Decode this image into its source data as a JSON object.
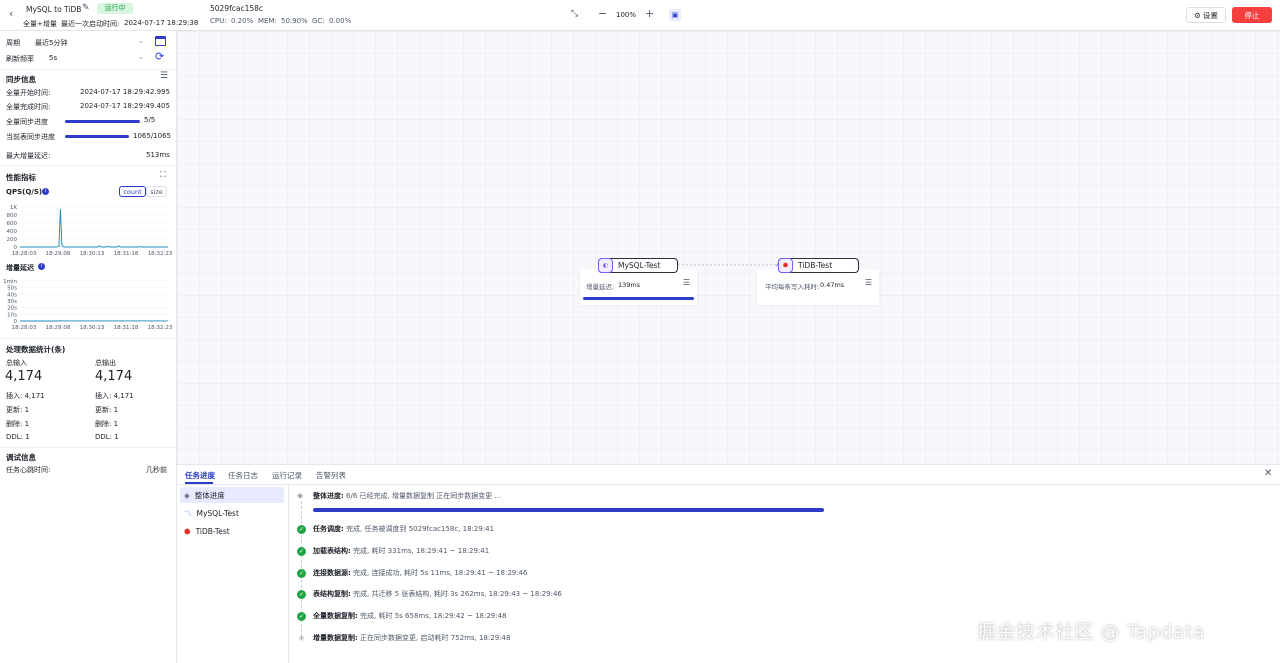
{
  "header": {
    "task_name": "MySQL to TiDB",
    "status_badge": "运行中",
    "sync_type": "全量+增量",
    "last_start_label": "最近一次启动时间:",
    "last_start_time": "2024-07-17 18:29:38",
    "task_id": "5029fcac158c",
    "cpu_label": "CPU:",
    "cpu_value": "0.20%",
    "mem_label": "MEM:",
    "mem_value": "50.90%",
    "gc_label": "GC:",
    "gc_value": "0.00%",
    "zoom": "100%",
    "settings_label": "设置",
    "stop_label": "停止",
    "accent": "#2c3cc8",
    "stop_color": "#f53f3f"
  },
  "left": {
    "period_label": "周期",
    "period_value": "最近5分钟",
    "refresh_label": "刷新频率",
    "refresh_value": "5s",
    "sync_info_title": "同步信息",
    "full_start_label": "全量开始时间:",
    "full_start_value": "2024-07-17 18:29:42.995",
    "full_done_label": "全量完成时间:",
    "full_done_value": "2024-07-17 18:29:49.405",
    "full_progress_label": "全量同步进度",
    "full_progress_value": "5/5",
    "full_progress_fraction": 1.0,
    "table_progress_label": "当前表同步进度",
    "table_progress_value": "1065/1065",
    "table_progress_fraction": 1.0,
    "max_delay_label": "最大增量延迟:",
    "max_delay_value": "513ms",
    "perf_title": "性能指标",
    "qps_label": "QPS(Q/S)",
    "count_btn": "count",
    "size_btn": "size",
    "delay_chart_label": "增量延迟",
    "stats_title": "处理数据统计(条)",
    "total_in_label": "总输入",
    "total_out_label": "总输出",
    "total_in_value": "4,174",
    "total_out_value": "4,174",
    "in_insert": "插入: 4,171",
    "in_update": "更新: 1",
    "in_delete": "删除: 1",
    "in_ddl": "DDL: 1",
    "out_insert": "插入: 4,171",
    "out_update": "更新: 1",
    "out_delete": "删除: 1",
    "out_ddl": "DDL: 1",
    "debug_title": "调试信息",
    "heartbeat_label": "任务心跳时间:",
    "heartbeat_value": "几秒前"
  },
  "chart_data": [
    {
      "type": "line",
      "title": "QPS(Q/S)",
      "yticks": [
        "1K",
        "800",
        "600",
        "400",
        "200",
        "0"
      ],
      "xticks": [
        "18:28:03",
        "18:29:08",
        "18:30:13",
        "18:31:18",
        "18:32:23"
      ],
      "ylim": [
        0,
        1000
      ],
      "series": [
        {
          "values": [
            0,
            0,
            0,
            0,
            0,
            0,
            0,
            0,
            0,
            0,
            0,
            0,
            0,
            0,
            0,
            0,
            0,
            0,
            0,
            0,
            0,
            0,
            0,
            0,
            0,
            5,
            20,
            950,
            60,
            5,
            0,
            0,
            0,
            0,
            0,
            0,
            0,
            0,
            0,
            0,
            0,
            0,
            0,
            0,
            0,
            0,
            0,
            0,
            0,
            0,
            0,
            0,
            0,
            30,
            5,
            0,
            0,
            0,
            0,
            20,
            0,
            0,
            0,
            0,
            0,
            0,
            30,
            5,
            0,
            0,
            0,
            0,
            0,
            0,
            0,
            0,
            0,
            0,
            0,
            0,
            10,
            0,
            0,
            0,
            0,
            0,
            0,
            0,
            0,
            0,
            0,
            0,
            0,
            0,
            0,
            0,
            0,
            0,
            0,
            0
          ]
        }
      ]
    },
    {
      "type": "line",
      "title": "增量延迟",
      "yticks": [
        "1min",
        "50s",
        "40s",
        "30s",
        "20s",
        "10s",
        "0"
      ],
      "xticks": [
        "18:28:03",
        "18:29:08",
        "18:30:13",
        "18:31:18",
        "18:32:23"
      ],
      "ylim": [
        0,
        60
      ],
      "series": [
        {
          "values": [
            0,
            0,
            0,
            0,
            0,
            0,
            0,
            0,
            0,
            0,
            0,
            0,
            0,
            0,
            0,
            0,
            0,
            0,
            0,
            0,
            0,
            0,
            0,
            0,
            0,
            0,
            0,
            0.5,
            0.3,
            0.2,
            0.1,
            0.2,
            0.3,
            0.2,
            0.1,
            0.2,
            0.3,
            0.2,
            0.1,
            0.2,
            0.3,
            0.2,
            0.1,
            0.2,
            0.3,
            0.2,
            0.1,
            0.2,
            0.3,
            0.2,
            0.1,
            0.2,
            0.3,
            0.2,
            0.1,
            0.2,
            0.3,
            0.2,
            0.1,
            0.2,
            0.3,
            0.2,
            0.1,
            0.2,
            0.3,
            0.2,
            0.1,
            0.2,
            0.3,
            0.2,
            0.1,
            0.2,
            0.3,
            0.2,
            0.1,
            0.2,
            0.3,
            0.2,
            0.1,
            0.2,
            0.3,
            0.2,
            0.1,
            0.2,
            0.3,
            0.2,
            0.1,
            0.2,
            0.3,
            0.2,
            0.1,
            0.2,
            0.3,
            0.2,
            0.1,
            0.2,
            0.3,
            0.2,
            0.1,
            0.2
          ]
        }
      ]
    }
  ],
  "canvas": {
    "source_name": "MySQL-Test",
    "target_name": "TiDB-Test",
    "source_metric_label": "增量延迟:",
    "source_metric_value": "139ms",
    "target_metric_label": "平均每条写入耗时:",
    "target_metric_value": "0.47ms"
  },
  "bottom": {
    "tabs": [
      "任务进度",
      "任务日志",
      "运行记录",
      "告警列表"
    ],
    "side_items": [
      "整体进度",
      "MySQL-Test",
      "TiDB-Test"
    ],
    "overall_label": "整体进度:",
    "overall_text": "6/6 已经完成, 增量数据复制 正在同步数据变更 ...",
    "overall_fraction": 1.0,
    "steps": [
      {
        "name": "任务调度:",
        "text": "完成, 任务被调度到 5029fcac158c, 18:29:41"
      },
      {
        "name": "加载表结构:",
        "text": "完成, 耗时 331ms, 18:29:41 ~ 18:29:41"
      },
      {
        "name": "连接数据源:",
        "text": "完成, 连接成功, 耗时 5s 11ms, 18:29:41 ~ 18:29:46"
      },
      {
        "name": "表结构复制:",
        "text": "完成, 共迁移 5 张表结构, 耗时 3s 262ms, 18:29:43 ~ 18:29:46"
      },
      {
        "name": "全量数据复制:",
        "text": "完成, 耗时 5s 658ms, 18:29:42 ~ 18:29:48"
      },
      {
        "name": "增量数据复制:",
        "text": "正在同步数据变更, 启动耗时 752ms, 18:29:48"
      }
    ]
  },
  "watermark": "掘金技术社区 @ Tapdata"
}
